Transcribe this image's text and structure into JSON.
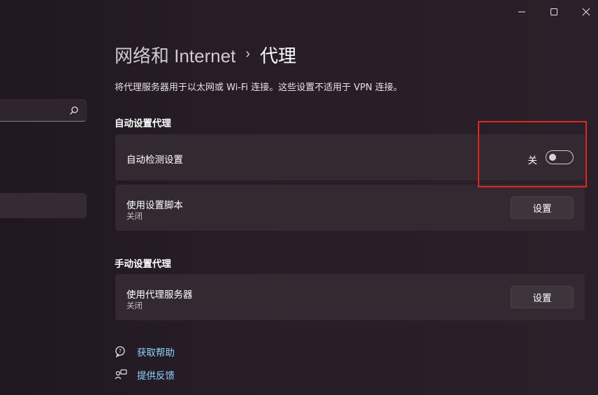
{
  "window": {
    "controls": [
      "minimize-icon",
      "maximize-icon",
      "close-icon"
    ]
  },
  "sidebar": {
    "search_placeholder": "",
    "search_icon": "search-icon"
  },
  "header": {
    "parent": "网络和 Internet",
    "separator": "›",
    "current": "代理"
  },
  "description": "将代理服务器用于以太网或 Wi-Fi 连接。这些设置不适用于 VPN 连接。",
  "auto_proxy": {
    "section_title": "自动设置代理",
    "detect": {
      "label": "自动检测设置",
      "toggle_label": "关",
      "toggle_on": false
    },
    "script": {
      "label": "使用设置脚本",
      "status": "关闭",
      "button": "设置"
    }
  },
  "manual_proxy": {
    "section_title": "手动设置代理",
    "server": {
      "label": "使用代理服务器",
      "status": "关闭",
      "button": "设置"
    }
  },
  "links": {
    "help": "获取帮助",
    "feedback": "提供反馈"
  },
  "colors": {
    "link": "#8fd4ff",
    "highlight": "#e3261f",
    "card": "#322931"
  }
}
